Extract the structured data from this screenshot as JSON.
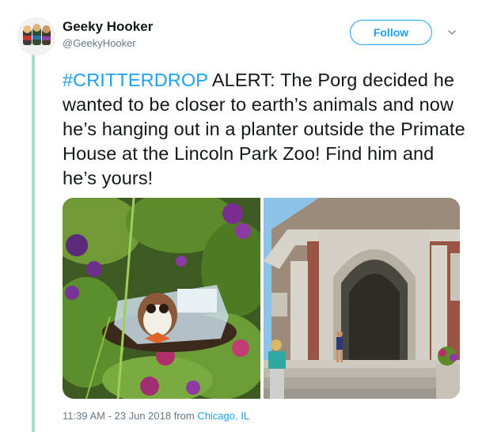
{
  "user": {
    "name": "Geeky Hooker",
    "handle": "@GeekyHooker"
  },
  "follow": {
    "label": "Follow"
  },
  "tweet": {
    "hashtag": "#CRITTERDROP",
    "text": " ALERT: The Porg decided he wanted to be closer to earth’s animals and now he’s hanging out in a planter outside the Primate House at the Lincoln Park Zoo! Find him and he’s yours!"
  },
  "meta": {
    "datetime": "11:39 AM - 23 Jun 2018 from ",
    "location": "Chicago, IL"
  },
  "icons": {
    "menu": "chevron-down-icon",
    "avatar": "avatar"
  },
  "colors": {
    "accent": "#1da1f2",
    "thread": "#a8dcc8",
    "secondary_text": "#657786"
  }
}
